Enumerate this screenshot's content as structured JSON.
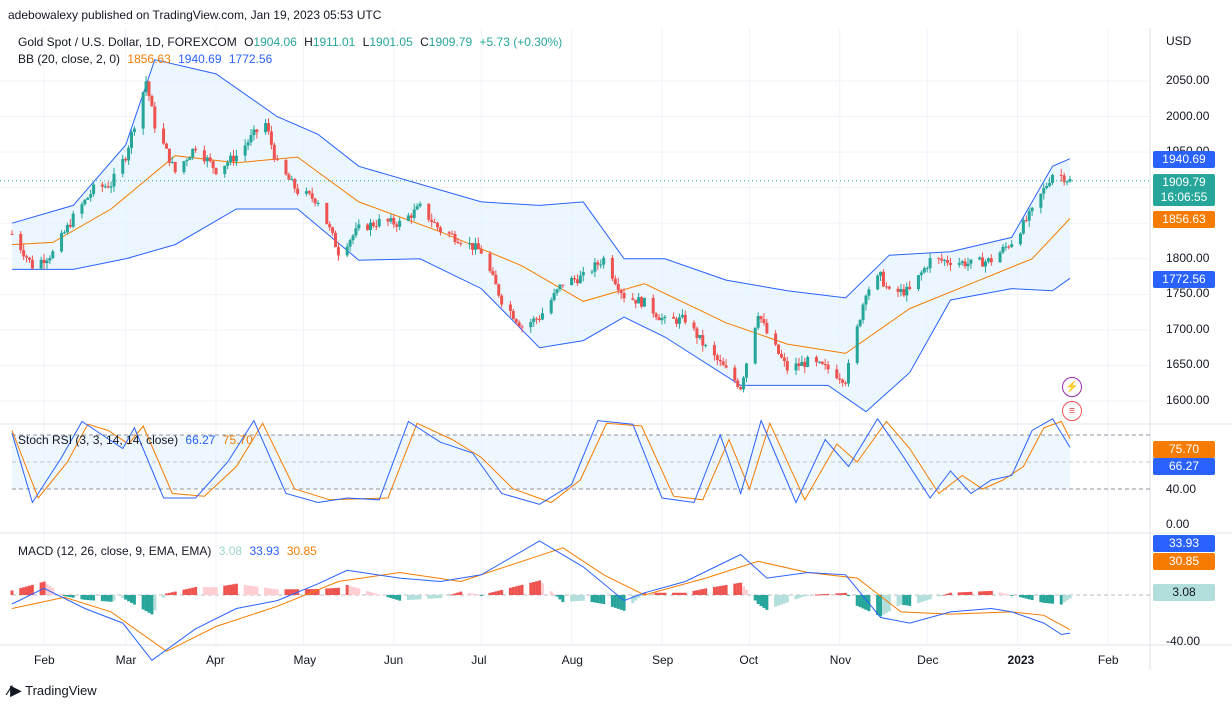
{
  "publisher": "adebowalexy published on TradingView.com, Jan 19, 2023 05:53 UTC",
  "footer": "TradingView",
  "currency": "USD",
  "header": {
    "symbol": "Gold Spot / U.S. Dollar, 1D, FOREXCOM",
    "o_lbl": "O",
    "o": "1904.06",
    "h_lbl": "H",
    "h": "1911.01",
    "l_lbl": "L",
    "l": "1901.05",
    "c_lbl": "C",
    "c": "1909.79",
    "chg": "+5.73 (+0.30%)",
    "bb_label": "BB (20, close, 2, 0)",
    "bb_basis": "1856.63",
    "bb_upper": "1940.69",
    "bb_lower": "1772.56"
  },
  "rsi_header": {
    "label": "Stoch RSI (3, 3, 14, 14, close)",
    "k": "66.27",
    "d": "75.70"
  },
  "macd_header": {
    "label": "MACD (12, 26, close, 9, EMA, EMA)",
    "hist": "3.08",
    "macd": "33.93",
    "signal": "30.85"
  },
  "price_axis": [
    "2050.00",
    "2000.00",
    "1950.00",
    "1900.00",
    "1850.00",
    "1800.00",
    "1750.00",
    "1700.00",
    "1650.00",
    "1600.00"
  ],
  "rsi_axis": [
    "40.00",
    "0.00"
  ],
  "macd_axis": [
    "-40.00"
  ],
  "price_tags": {
    "upper": "1940.69",
    "close": "1909.79",
    "countdown": "16:06:55",
    "basis": "1856.63",
    "lower": "1772.56"
  },
  "rsi_tags": {
    "d": "75.70",
    "k": "66.27"
  },
  "macd_tags": {
    "macd": "33.93",
    "signal": "30.85",
    "hist": "3.08"
  },
  "months": [
    "Feb",
    "Mar",
    "Apr",
    "May",
    "Jun",
    "Jul",
    "Aug",
    "Sep",
    "Oct",
    "Nov",
    "Dec",
    "2023",
    "Feb"
  ],
  "colors": {
    "up": "#26a69a",
    "down": "#ef5350",
    "bb": "#2962ff",
    "basis": "#f57c00",
    "fill": "#e3f2fd"
  },
  "chart_data": {
    "type": "candlestick",
    "title": "Gold Spot / U.S. Dollar, 1D, FOREXCOM",
    "ylabel": "USD",
    "ylim": [
      1570,
      2090
    ],
    "x_range": [
      "2022-01-21",
      "2023-01-19"
    ],
    "last": {
      "open": 1904.06,
      "high": 1911.01,
      "low": 1901.05,
      "close": 1909.79
    },
    "close_path": [
      [
        "2022-01-21",
        1835
      ],
      [
        "2022-01-28",
        1790
      ],
      [
        "2022-02-04",
        1808
      ],
      [
        "2022-02-11",
        1858
      ],
      [
        "2022-02-18",
        1898
      ],
      [
        "2022-02-24",
        1905
      ],
      [
        "2022-03-01",
        1945
      ],
      [
        "2022-03-08",
        2050
      ],
      [
        "2022-03-11",
        1988
      ],
      [
        "2022-03-18",
        1922
      ],
      [
        "2022-03-25",
        1958
      ],
      [
        "2022-04-01",
        1925
      ],
      [
        "2022-04-08",
        1945
      ],
      [
        "2022-04-14",
        1975
      ],
      [
        "2022-04-18",
        1990
      ],
      [
        "2022-04-22",
        1932
      ],
      [
        "2022-04-29",
        1895
      ],
      [
        "2022-05-06",
        1882
      ],
      [
        "2022-05-13",
        1810
      ],
      [
        "2022-05-20",
        1842
      ],
      [
        "2022-05-27",
        1852
      ],
      [
        "2022-06-03",
        1850
      ],
      [
        "2022-06-10",
        1872
      ],
      [
        "2022-06-17",
        1840
      ],
      [
        "2022-06-24",
        1827
      ],
      [
        "2022-07-01",
        1810
      ],
      [
        "2022-07-08",
        1742
      ],
      [
        "2022-07-15",
        1705
      ],
      [
        "2022-07-21",
        1718
      ],
      [
        "2022-07-29",
        1766
      ],
      [
        "2022-08-05",
        1775
      ],
      [
        "2022-08-12",
        1800
      ],
      [
        "2022-08-19",
        1748
      ],
      [
        "2022-08-26",
        1738
      ],
      [
        "2022-09-02",
        1712
      ],
      [
        "2022-09-09",
        1715
      ],
      [
        "2022-09-16",
        1675
      ],
      [
        "2022-09-23",
        1643
      ],
      [
        "2022-09-28",
        1620
      ],
      [
        "2022-10-04",
        1725
      ],
      [
        "2022-10-07",
        1695
      ],
      [
        "2022-10-14",
        1645
      ],
      [
        "2022-10-21",
        1655
      ],
      [
        "2022-10-28",
        1645
      ],
      [
        "2022-11-03",
        1630
      ],
      [
        "2022-11-10",
        1755
      ],
      [
        "2022-11-15",
        1775
      ],
      [
        "2022-11-18",
        1752
      ],
      [
        "2022-11-25",
        1755
      ],
      [
        "2022-12-02",
        1798
      ],
      [
        "2022-12-09",
        1797
      ],
      [
        "2022-12-16",
        1793
      ],
      [
        "2022-12-23",
        1798
      ],
      [
        "2022-12-30",
        1824
      ],
      [
        "2023-01-06",
        1866
      ],
      [
        "2023-01-13",
        1920
      ],
      [
        "2023-01-16",
        1917
      ],
      [
        "2023-01-19",
        1909.79
      ]
    ],
    "bb_upper_path": [
      [
        "2022-01-21",
        1850
      ],
      [
        "2022-02-11",
        1875
      ],
      [
        "2022-03-01",
        1960
      ],
      [
        "2022-03-11",
        2080
      ],
      [
        "2022-04-01",
        2060
      ],
      [
        "2022-04-22",
        2000
      ],
      [
        "2022-05-06",
        1975
      ],
      [
        "2022-05-20",
        1930
      ],
      [
        "2022-06-10",
        1905
      ],
      [
        "2022-07-01",
        1880
      ],
      [
        "2022-07-21",
        1875
      ],
      [
        "2022-08-05",
        1880
      ],
      [
        "2022-08-19",
        1800
      ],
      [
        "2022-09-02",
        1800
      ],
      [
        "2022-09-23",
        1770
      ],
      [
        "2022-10-14",
        1755
      ],
      [
        "2022-11-03",
        1745
      ],
      [
        "2022-11-18",
        1805
      ],
      [
        "2022-12-09",
        1810
      ],
      [
        "2022-12-30",
        1830
      ],
      [
        "2023-01-13",
        1930
      ],
      [
        "2023-01-19",
        1940.69
      ]
    ],
    "bb_basis_path": [
      [
        "2022-01-21",
        1820
      ],
      [
        "2022-02-04",
        1823
      ],
      [
        "2022-02-24",
        1870
      ],
      [
        "2022-03-18",
        1945
      ],
      [
        "2022-04-08",
        1935
      ],
      [
        "2022-04-29",
        1943
      ],
      [
        "2022-05-20",
        1880
      ],
      [
        "2022-06-17",
        1838
      ],
      [
        "2022-07-15",
        1790
      ],
      [
        "2022-08-05",
        1740
      ],
      [
        "2022-08-26",
        1765
      ],
      [
        "2022-09-23",
        1710
      ],
      [
        "2022-10-14",
        1680
      ],
      [
        "2022-11-03",
        1667
      ],
      [
        "2022-11-25",
        1730
      ],
      [
        "2022-12-16",
        1765
      ],
      [
        "2023-01-06",
        1800
      ],
      [
        "2023-01-19",
        1856.63
      ]
    ],
    "bb_lower_path": [
      [
        "2022-01-21",
        1785
      ],
      [
        "2022-02-11",
        1785
      ],
      [
        "2022-03-01",
        1800
      ],
      [
        "2022-03-18",
        1820
      ],
      [
        "2022-04-08",
        1870
      ],
      [
        "2022-04-29",
        1870
      ],
      [
        "2022-05-20",
        1798
      ],
      [
        "2022-06-10",
        1800
      ],
      [
        "2022-07-01",
        1758
      ],
      [
        "2022-07-21",
        1675
      ],
      [
        "2022-08-05",
        1685
      ],
      [
        "2022-08-19",
        1718
      ],
      [
        "2022-09-02",
        1690
      ],
      [
        "2022-09-28",
        1622
      ],
      [
        "2022-10-28",
        1622
      ],
      [
        "2022-11-10",
        1585
      ],
      [
        "2022-11-25",
        1640
      ],
      [
        "2022-12-09",
        1742
      ],
      [
        "2022-12-30",
        1758
      ],
      [
        "2023-01-13",
        1755
      ],
      [
        "2023-01-19",
        1772.56
      ]
    ],
    "stoch_rsi": {
      "ylim": [
        0,
        100
      ],
      "bands": [
        20,
        80
      ],
      "k_last": 66.27,
      "d_last": 75.7,
      "k_path": [
        [
          "2022-01-21",
          82
        ],
        [
          "2022-01-28",
          5
        ],
        [
          "2022-02-07",
          55
        ],
        [
          "2022-02-14",
          95
        ],
        [
          "2022-02-21",
          80
        ],
        [
          "2022-02-28",
          65
        ],
        [
          "2022-03-04",
          88
        ],
        [
          "2022-03-14",
          10
        ],
        [
          "2022-03-25",
          10
        ],
        [
          "2022-04-05",
          50
        ],
        [
          "2022-04-14",
          96
        ],
        [
          "2022-04-25",
          15
        ],
        [
          "2022-05-06",
          5
        ],
        [
          "2022-05-16",
          10
        ],
        [
          "2022-05-27",
          8
        ],
        [
          "2022-06-06",
          95
        ],
        [
          "2022-06-17",
          72
        ],
        [
          "2022-06-28",
          60
        ],
        [
          "2022-07-08",
          15
        ],
        [
          "2022-07-21",
          3
        ],
        [
          "2022-08-01",
          25
        ],
        [
          "2022-08-10",
          96
        ],
        [
          "2022-08-22",
          92
        ],
        [
          "2022-09-01",
          10
        ],
        [
          "2022-09-12",
          5
        ],
        [
          "2022-09-21",
          80
        ],
        [
          "2022-09-28",
          15
        ],
        [
          "2022-10-05",
          96
        ],
        [
          "2022-10-17",
          5
        ],
        [
          "2022-10-27",
          75
        ],
        [
          "2022-11-04",
          45
        ],
        [
          "2022-11-14",
          98
        ],
        [
          "2022-11-22",
          60
        ],
        [
          "2022-12-02",
          10
        ],
        [
          "2022-12-09",
          40
        ],
        [
          "2022-12-16",
          15
        ],
        [
          "2022-12-23",
          30
        ],
        [
          "2022-12-30",
          35
        ],
        [
          "2023-01-06",
          85
        ],
        [
          "2023-01-13",
          98
        ],
        [
          "2023-01-19",
          66.27
        ]
      ],
      "d_path": [
        [
          "2022-01-21",
          85
        ],
        [
          "2022-01-30",
          10
        ],
        [
          "2022-02-09",
          50
        ],
        [
          "2022-02-16",
          92
        ],
        [
          "2022-02-23",
          85
        ],
        [
          "2022-03-02",
          70
        ],
        [
          "2022-03-07",
          90
        ],
        [
          "2022-03-17",
          15
        ],
        [
          "2022-03-28",
          12
        ],
        [
          "2022-04-08",
          45
        ],
        [
          "2022-04-17",
          93
        ],
        [
          "2022-04-28",
          20
        ],
        [
          "2022-05-10",
          8
        ],
        [
          "2022-05-30",
          10
        ],
        [
          "2022-06-09",
          93
        ],
        [
          "2022-06-21",
          75
        ],
        [
          "2022-07-01",
          55
        ],
        [
          "2022-07-12",
          20
        ],
        [
          "2022-07-25",
          5
        ],
        [
          "2022-08-04",
          30
        ],
        [
          "2022-08-13",
          93
        ],
        [
          "2022-08-25",
          90
        ],
        [
          "2022-09-05",
          12
        ],
        [
          "2022-09-15",
          8
        ],
        [
          "2022-09-24",
          75
        ],
        [
          "2022-10-01",
          20
        ],
        [
          "2022-10-08",
          93
        ],
        [
          "2022-10-20",
          8
        ],
        [
          "2022-10-31",
          70
        ],
        [
          "2022-11-07",
          50
        ],
        [
          "2022-11-17",
          95
        ],
        [
          "2022-11-25",
          65
        ],
        [
          "2022-12-05",
          15
        ],
        [
          "2022-12-13",
          35
        ],
        [
          "2022-12-20",
          20
        ],
        [
          "2022-12-27",
          30
        ],
        [
          "2023-01-03",
          45
        ],
        [
          "2023-01-10",
          88
        ],
        [
          "2023-01-16",
          95
        ],
        [
          "2023-01-19",
          75.7
        ]
      ]
    },
    "macd": {
      "macd_last": 33.93,
      "signal_last": 30.85,
      "hist_last": 3.08,
      "macd_path": [
        [
          "2022-01-21",
          8
        ],
        [
          "2022-02-01",
          -6
        ],
        [
          "2022-02-15",
          12
        ],
        [
          "2022-02-28",
          25
        ],
        [
          "2022-03-10",
          58
        ],
        [
          "2022-03-25",
          30
        ],
        [
          "2022-04-08",
          12
        ],
        [
          "2022-04-22",
          5
        ],
        [
          "2022-05-06",
          -10
        ],
        [
          "2022-05-16",
          -22
        ],
        [
          "2022-06-03",
          -15
        ],
        [
          "2022-06-17",
          -12
        ],
        [
          "2022-07-01",
          -18
        ],
        [
          "2022-07-21",
          -48
        ],
        [
          "2022-08-05",
          -25
        ],
        [
          "2022-08-19",
          5
        ],
        [
          "2022-08-26",
          -2
        ],
        [
          "2022-09-09",
          -12
        ],
        [
          "2022-09-28",
          -36
        ],
        [
          "2022-10-07",
          -15
        ],
        [
          "2022-10-21",
          -20
        ],
        [
          "2022-11-03",
          -18
        ],
        [
          "2022-11-15",
          20
        ],
        [
          "2022-11-25",
          25
        ],
        [
          "2022-12-09",
          15
        ],
        [
          "2022-12-23",
          12
        ],
        [
          "2022-12-30",
          15
        ],
        [
          "2023-01-10",
          25
        ],
        [
          "2023-01-16",
          35
        ],
        [
          "2023-01-19",
          33.93
        ]
      ],
      "signal_path": [
        [
          "2022-01-21",
          12
        ],
        [
          "2022-02-08",
          2
        ],
        [
          "2022-02-24",
          15
        ],
        [
          "2022-03-15",
          50
        ],
        [
          "2022-04-01",
          28
        ],
        [
          "2022-04-22",
          10
        ],
        [
          "2022-05-13",
          -12
        ],
        [
          "2022-06-03",
          -20
        ],
        [
          "2022-06-24",
          -12
        ],
        [
          "2022-07-15",
          -30
        ],
        [
          "2022-07-29",
          -42
        ],
        [
          "2022-08-12",
          -18
        ],
        [
          "2022-08-26",
          0
        ],
        [
          "2022-09-16",
          -15
        ],
        [
          "2022-10-04",
          -30
        ],
        [
          "2022-10-21",
          -20
        ],
        [
          "2022-11-07",
          -15
        ],
        [
          "2022-11-22",
          15
        ],
        [
          "2022-12-09",
          17
        ],
        [
          "2022-12-30",
          15
        ],
        [
          "2023-01-10",
          18
        ],
        [
          "2023-01-19",
          30.85
        ]
      ]
    }
  }
}
